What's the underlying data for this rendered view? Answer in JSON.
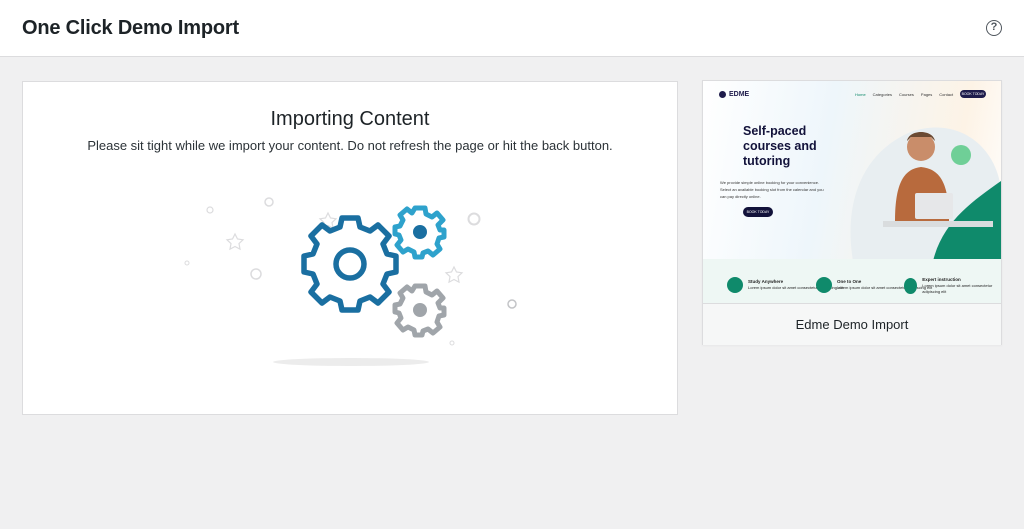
{
  "header": {
    "title": "One Click Demo Import",
    "help_label": "?"
  },
  "import_panel": {
    "heading": "Importing Content",
    "message": "Please sit tight while we import your content. Do not refresh the page or hit the back button.",
    "icon": "gears-icon",
    "colors": {
      "gear_blue_dark": "#1a6fa1",
      "gear_blue_light": "#2ea2cc",
      "gear_grey": "#a0a5aa"
    }
  },
  "demo_card": {
    "name": "Edme Demo Import",
    "preview": {
      "logo": "EDME",
      "nav": [
        "Home",
        "Categories",
        "Courses",
        "Pages",
        "Contact"
      ],
      "nav_button": "BOOK TODAY",
      "hero_lines": [
        "Self-paced",
        "courses and",
        "tutoring"
      ],
      "hero_text": "We provide simple online booking for your convenience. Select an available booking slot from the calendar and you can pay directly online.",
      "hero_button": "BOOK TODAY",
      "features": [
        {
          "title": "Study Anywhere",
          "text": "Lorem ipsum dolor sit amet consectetur adipiscing elit"
        },
        {
          "title": "One to One",
          "text": "Lorem ipsum dolor sit amet consectetur adipiscing elit"
        },
        {
          "title": "Expert instruction",
          "text": "Lorem ipsum dolor sit amet consectetur adipiscing elit"
        }
      ],
      "colors": {
        "navy": "#12123a",
        "green": "#0f8a6b"
      }
    }
  }
}
